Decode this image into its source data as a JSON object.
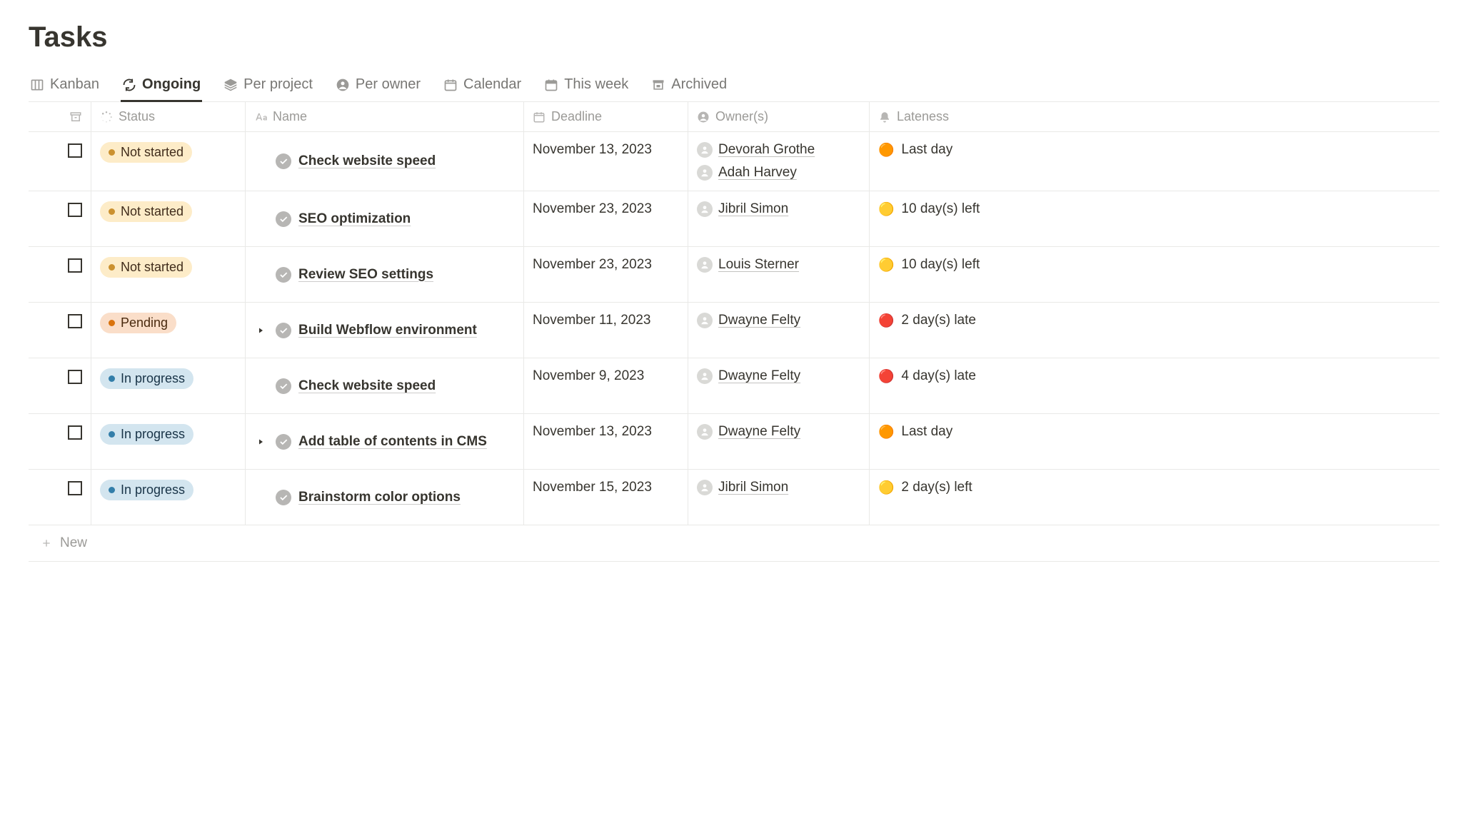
{
  "page_title": "Tasks",
  "tabs": [
    {
      "id": "kanban",
      "label": "Kanban",
      "active": false
    },
    {
      "id": "ongoing",
      "label": "Ongoing",
      "active": true
    },
    {
      "id": "per-project",
      "label": "Per project",
      "active": false
    },
    {
      "id": "per-owner",
      "label": "Per owner",
      "active": false
    },
    {
      "id": "calendar",
      "label": "Calendar",
      "active": false
    },
    {
      "id": "this-week",
      "label": "This week",
      "active": false
    },
    {
      "id": "archived",
      "label": "Archived",
      "active": false
    }
  ],
  "columns": {
    "status": "Status",
    "name": "Name",
    "deadline": "Deadline",
    "owners": "Owner(s)",
    "lateness": "Lateness"
  },
  "rows": [
    {
      "status": "not-started",
      "status_label": "Not started",
      "has_toggle": false,
      "name": "Check website speed",
      "deadline": "November 13, 2023",
      "owners": [
        "Devorah Grothe",
        "Adah Harvey"
      ],
      "lateness_emoji": "🟠",
      "lateness_text": "Last day"
    },
    {
      "status": "not-started",
      "status_label": "Not started",
      "has_toggle": false,
      "name": "SEO optimization",
      "deadline": "November 23, 2023",
      "owners": [
        "Jibril Simon"
      ],
      "lateness_emoji": "🟡",
      "lateness_text": "10 day(s) left"
    },
    {
      "status": "not-started",
      "status_label": "Not started",
      "has_toggle": false,
      "name": "Review SEO settings",
      "deadline": "November 23, 2023",
      "owners": [
        "Louis Sterner"
      ],
      "lateness_emoji": "🟡",
      "lateness_text": "10 day(s) left"
    },
    {
      "status": "pending",
      "status_label": "Pending",
      "has_toggle": true,
      "name": "Build Webflow environment",
      "deadline": "November 11, 2023",
      "owners": [
        "Dwayne Felty"
      ],
      "lateness_emoji": "🔴",
      "lateness_text": "2 day(s) late"
    },
    {
      "status": "in-progress",
      "status_label": "In progress",
      "has_toggle": false,
      "name": "Check website speed",
      "deadline": "November 9, 2023",
      "owners": [
        "Dwayne Felty"
      ],
      "lateness_emoji": "🔴",
      "lateness_text": "4 day(s) late"
    },
    {
      "status": "in-progress",
      "status_label": "In progress",
      "has_toggle": true,
      "name": "Add table of contents in CMS",
      "deadline": "November 13, 2023",
      "owners": [
        "Dwayne Felty"
      ],
      "lateness_emoji": "🟠",
      "lateness_text": "Last day"
    },
    {
      "status": "in-progress",
      "status_label": "In progress",
      "has_toggle": false,
      "name": "Brainstorm color options",
      "deadline": "November 15, 2023",
      "owners": [
        "Jibril Simon"
      ],
      "lateness_emoji": "🟡",
      "lateness_text": "2 day(s) left"
    }
  ],
  "new_label": "New"
}
